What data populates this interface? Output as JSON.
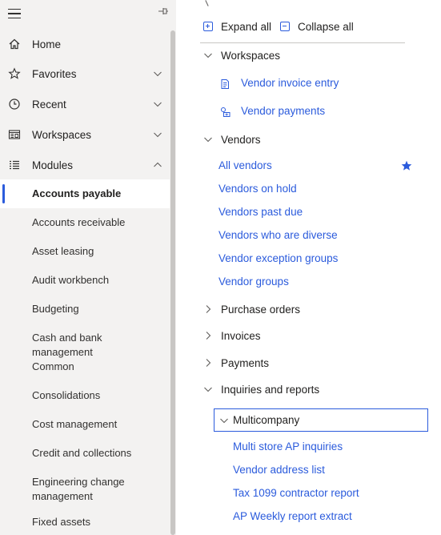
{
  "nav": {
    "items": [
      {
        "label": "Home",
        "icon": "home-icon"
      },
      {
        "label": "Favorites",
        "icon": "star-icon"
      },
      {
        "label": "Recent",
        "icon": "clock-icon"
      },
      {
        "label": "Workspaces",
        "icon": "workspaces-icon"
      },
      {
        "label": "Modules",
        "icon": "list-icon"
      }
    ],
    "modules": [
      "Accounts payable",
      "Accounts receivable",
      "Asset leasing",
      "Audit workbench",
      "Budgeting",
      "Cash and bank management",
      "Common",
      "Consolidations",
      "Cost management",
      "Credit and collections",
      "Engineering change management",
      "Fixed assets"
    ],
    "selected_module": "Accounts payable"
  },
  "toolbar": {
    "expand_all": "Expand all",
    "collapse_all": "Collapse all"
  },
  "sections": {
    "workspaces": {
      "label": "Workspaces",
      "links": [
        "Vendor invoice entry",
        "Vendor payments"
      ]
    },
    "vendors": {
      "label": "Vendors",
      "links": [
        "All vendors",
        "Vendors on hold",
        "Vendors past due",
        "Vendors who are diverse",
        "Vendor exception groups",
        "Vendor groups"
      ]
    },
    "purchase_orders": {
      "label": "Purchase orders"
    },
    "invoices": {
      "label": "Invoices"
    },
    "payments": {
      "label": "Payments"
    },
    "inquiries": {
      "label": "Inquiries and reports",
      "multicompany": {
        "label": "Multicompany",
        "links": [
          "Multi store AP inquiries",
          "Vendor address list",
          "Tax 1099 contractor report",
          "AP Weekly report extract"
        ]
      }
    }
  },
  "colors": {
    "accent": "#2b5bdc",
    "nav_bg": "#f3f2f1",
    "text": "#201f1e"
  }
}
